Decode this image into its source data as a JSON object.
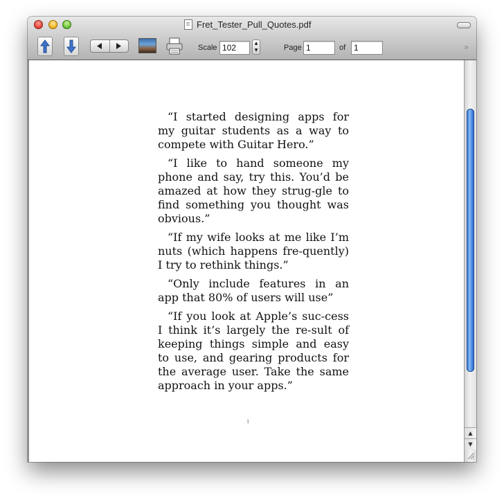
{
  "window": {
    "title": "Fret_Tester_Pull_Quotes.pdf"
  },
  "toolbar": {
    "scale_label": "Scale",
    "scale_value": "102",
    "page_label": "Page",
    "page_value": "1",
    "of_label": "of",
    "total_pages": "1",
    "overflow_glyph": "»"
  },
  "document": {
    "quotes": [
      "“I started designing apps for my guitar students as a way to compete with Guitar Hero.”",
      "“I like to hand someone my phone and say, try this. You’d be amazed at how they strug-gle to find something you thought was obvious.”",
      "“If my wife looks at me like I’m nuts (which happens fre-quently) I try to rethink things.”",
      "“Only include features in an app that 80% of users will use”",
      "“If you look at Apple’s suc-cess I think it’s largely the re-sult of keeping things simple and easy to use, and gearing products for the average user. Take the same approach in your apps.”"
    ],
    "page_number": "1"
  },
  "scrollbar": {
    "up_glyph": "▲",
    "down_glyph": "▼"
  },
  "colors": {
    "scroll_thumb": "#3f7ee0",
    "titlebar_top": "#e8e8e8",
    "titlebar_bottom": "#b3b3b3"
  },
  "icons": {
    "scroll_up_page": "arrow-up-icon",
    "scroll_down_page": "arrow-down-icon",
    "previous": "triangle-left-icon",
    "next": "triangle-right-icon",
    "image": "photo-icon",
    "print": "printer-icon"
  }
}
